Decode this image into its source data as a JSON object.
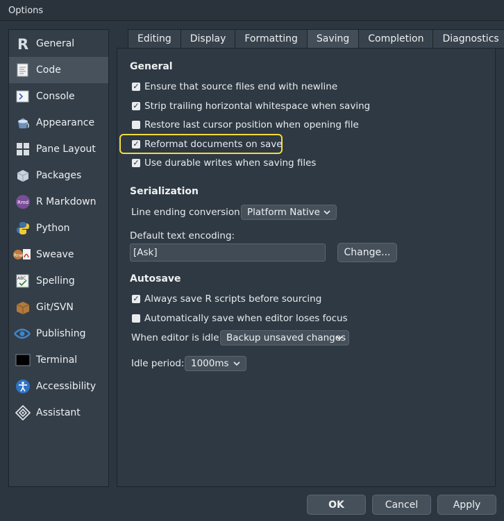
{
  "window": {
    "title": "Options"
  },
  "sidebar": {
    "items": [
      {
        "label": "General",
        "icon": "r-logo-icon"
      },
      {
        "label": "Code",
        "icon": "code-document-icon"
      },
      {
        "label": "Console",
        "icon": "console-icon"
      },
      {
        "label": "Appearance",
        "icon": "paint-bucket-icon"
      },
      {
        "label": "Pane Layout",
        "icon": "pane-layout-icon"
      },
      {
        "label": "Packages",
        "icon": "package-box-icon"
      },
      {
        "label": "R Markdown",
        "icon": "rmarkdown-icon"
      },
      {
        "label": "Python",
        "icon": "python-icon"
      },
      {
        "label": "Sweave",
        "icon": "sweave-pdf-icon"
      },
      {
        "label": "Spelling",
        "icon": "spelling-abc-icon"
      },
      {
        "label": "Git/SVN",
        "icon": "git-box-icon"
      },
      {
        "label": "Publishing",
        "icon": "publishing-icon"
      },
      {
        "label": "Terminal",
        "icon": "terminal-icon"
      },
      {
        "label": "Accessibility",
        "icon": "accessibility-icon"
      },
      {
        "label": "Assistant",
        "icon": "assistant-icon"
      }
    ],
    "active": "Code"
  },
  "tabs": [
    "Editing",
    "Display",
    "Formatting",
    "Saving",
    "Completion",
    "Diagnostics"
  ],
  "active_tab": "Saving",
  "general": {
    "heading": "General",
    "options": [
      {
        "label": "Ensure that source files end with newline",
        "checked": true
      },
      {
        "label": "Strip trailing horizontal whitespace when saving",
        "checked": true
      },
      {
        "label": "Restore last cursor position when opening file",
        "checked": false
      },
      {
        "label": "Reformat documents on save",
        "checked": true
      },
      {
        "label": "Use durable writes when saving files",
        "checked": true
      }
    ]
  },
  "serialization": {
    "heading": "Serialization",
    "line_ending_label": "Line ending conversion:",
    "line_ending_value": "Platform Native",
    "encoding_label": "Default text encoding:",
    "encoding_value": "[Ask]",
    "change_button": "Change..."
  },
  "autosave": {
    "heading": "Autosave",
    "options": [
      {
        "label": "Always save R scripts before sourcing",
        "checked": true
      },
      {
        "label": "Automatically save when editor loses focus",
        "checked": false
      }
    ],
    "idle_label": "When editor is idle:",
    "idle_value": "Backup unsaved changes",
    "period_label": "Idle period:",
    "period_value": "1000ms"
  },
  "footer": {
    "ok": "OK",
    "cancel": "Cancel",
    "apply": "Apply"
  },
  "colors": {
    "highlight": "#f3dc3b",
    "active_item": "#47525d"
  }
}
